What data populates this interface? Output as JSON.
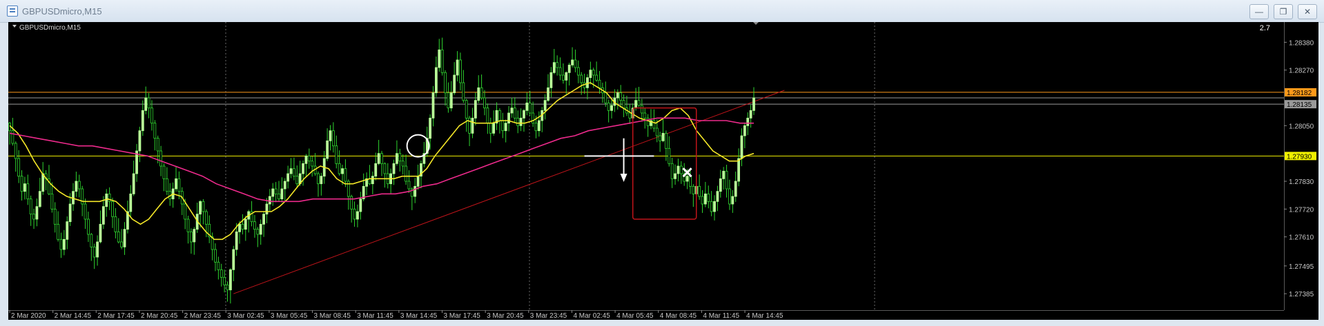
{
  "window": {
    "title": "GBPUSDmicro,M15",
    "minimize_icon": "minimize-icon",
    "restore_icon": "restore-icon",
    "close_icon": "close-icon",
    "minimize_glyph": "—",
    "restore_glyph": "❐",
    "close_glyph": "✕"
  },
  "chart_data": {
    "type": "candlestick",
    "symbol_label": "GBPUSDmicro,M15",
    "top_right_value": "2.7",
    "ylim": [
      1.2732,
      1.2846
    ],
    "y_ticks": [
      "1.28380",
      "1.28270",
      "1.28050",
      "1.27830",
      "1.27720",
      "1.27610",
      "1.27495",
      "1.27385"
    ],
    "x_ticks": [
      "2 Mar 2020",
      "2 Mar 14:45",
      "2 Mar 17:45",
      "2 Mar 20:45",
      "2 Mar 23:45",
      "3 Mar 02:45",
      "3 Mar 05:45",
      "3 Mar 08:45",
      "3 Mar 11:45",
      "3 Mar 14:45",
      "3 Mar 17:45",
      "3 Mar 20:45",
      "3 Mar 23:45",
      "4 Mar 02:45",
      "4 Mar 05:45",
      "4 Mar 08:45",
      "4 Mar 11:45",
      "4 Mar 14:45"
    ],
    "price_labels": [
      {
        "text": "1.28182",
        "value": 1.28182,
        "color": "#ff9a1a",
        "text_color": "#000000"
      },
      {
        "text": "1.28135",
        "value": 1.28135,
        "color": "#9a9a9a",
        "text_color": "#000000"
      },
      {
        "text": "1.27930",
        "value": 1.2793,
        "color": "#f0f000",
        "text_color": "#000000"
      }
    ],
    "horizontal_lines": [
      {
        "value": 1.28182,
        "color": "#ff9a1a"
      },
      {
        "value": 1.2816,
        "color": "#9a9a9a"
      },
      {
        "value": 1.28135,
        "color": "#9a9a9a"
      },
      {
        "value": 1.2793,
        "color": "#f0f000"
      }
    ],
    "closes": [
      1.2803,
      1.2798,
      1.2792,
      1.2785,
      1.2779,
      1.2782,
      1.2776,
      1.277,
      1.2768,
      1.2773,
      1.2779,
      1.2786,
      1.2784,
      1.2778,
      1.2772,
      1.2766,
      1.276,
      1.2756,
      1.276,
      1.2767,
      1.2774,
      1.2779,
      1.2783,
      1.278,
      1.2774,
      1.2768,
      1.2762,
      1.2757,
      1.2753,
      1.2759,
      1.2766,
      1.2773,
      1.2778,
      1.2775,
      1.2769,
      1.2763,
      1.2759,
      1.2757,
      1.2764,
      1.2771,
      1.2778,
      1.2786,
      1.2795,
      1.2803,
      1.2811,
      1.2816,
      1.2812,
      1.2806,
      1.28,
      1.2795,
      1.2789,
      1.2784,
      1.2779,
      1.2776,
      1.278,
      1.2784,
      1.2779,
      1.2774,
      1.2768,
      1.2763,
      1.2759,
      1.2764,
      1.277,
      1.2775,
      1.2771,
      1.2766,
      1.2761,
      1.2756,
      1.2751,
      1.2748,
      1.2745,
      1.2742,
      1.274,
      1.2748,
      1.2756,
      1.2763,
      1.2766,
      1.2764,
      1.2768,
      1.2771,
      1.2767,
      1.2764,
      1.2762,
      1.2766,
      1.277,
      1.2774,
      1.2777,
      1.278,
      1.2778,
      1.2776,
      1.278,
      1.2783,
      1.2786,
      1.2788,
      1.2785,
      1.2782,
      1.2786,
      1.279,
      1.2793,
      1.2791,
      1.2789,
      1.2786,
      1.2782,
      1.2785,
      1.2792,
      1.2799,
      1.2803,
      1.2797,
      1.279,
      1.2786,
      1.2788,
      1.2783,
      1.2777,
      1.2772,
      1.2768,
      1.2771,
      1.2776,
      1.2781,
      1.2784,
      1.2782,
      1.2785,
      1.279,
      1.2794,
      1.279,
      1.2786,
      1.2782,
      1.2786,
      1.279,
      1.2794,
      1.2791,
      1.2789,
      1.2783,
      1.278,
      1.2777,
      1.2781,
      1.2785,
      1.279,
      1.2794,
      1.28,
      1.2808,
      1.2818,
      1.2828,
      1.2835,
      1.2826,
      1.2818,
      1.2812,
      1.2818,
      1.2825,
      1.2831,
      1.2822,
      1.2815,
      1.2808,
      1.2802,
      1.2808,
      1.2815,
      1.282,
      1.2816,
      1.2812,
      1.2806,
      1.2802,
      1.2806,
      1.2811,
      1.2807,
      1.2803,
      1.2806,
      1.281,
      1.2812,
      1.2808,
      1.2805,
      1.2808,
      1.2811,
      1.2814,
      1.281,
      1.2806,
      1.2803,
      1.2807,
      1.2811,
      1.2815,
      1.282,
      1.2826,
      1.283,
      1.2828,
      1.2825,
      1.2823,
      1.2826,
      1.2829,
      1.2831,
      1.2828,
      1.2825,
      1.2822,
      1.282,
      1.2824,
      1.2827,
      1.2825,
      1.2823,
      1.282,
      1.2818,
      1.2814,
      1.2811,
      1.2813,
      1.2816,
      1.2818,
      1.2815,
      1.2812,
      1.281,
      1.2808,
      1.2812,
      1.2815,
      1.2813,
      1.281,
      1.2808,
      1.2805,
      1.2807,
      1.2804,
      1.2801,
      1.2799,
      1.2802,
      1.2796,
      1.279,
      1.2784,
      1.2786,
      1.2789,
      1.2786,
      1.2783,
      1.2785,
      1.2781,
      1.2778,
      1.2781,
      1.2777,
      1.2774,
      1.2778,
      1.2775,
      1.2771,
      1.2775,
      1.2779,
      1.2784,
      1.2787,
      1.278,
      1.2774,
      1.2777,
      1.2783,
      1.2792,
      1.2801,
      1.2805,
      1.2808,
      1.2811,
      1.2816
    ],
    "candle_count": 247,
    "series": [
      {
        "name": "",
        "color": "#f5e828",
        "values": [
          1.2805,
          1.2802,
          1.2797,
          1.2791,
          1.2786,
          1.2782,
          1.2779,
          1.2777,
          1.2776,
          1.2775,
          1.2775,
          1.2775,
          1.2776,
          1.2775,
          1.2772,
          1.2768,
          1.2766,
          1.2768,
          1.2772,
          1.2776,
          1.2778,
          1.2777,
          1.2772,
          1.2767,
          1.2763,
          1.276,
          1.276,
          1.2762,
          1.2766,
          1.2769,
          1.2771,
          1.2771,
          1.2771,
          1.2773,
          1.2776,
          1.278,
          1.2784,
          1.2787,
          1.2789,
          1.2788,
          1.2784,
          1.2782,
          1.2782,
          1.2783,
          1.2784,
          1.2784,
          1.2784,
          1.2784,
          1.2785,
          1.2785,
          1.2785,
          1.2788,
          1.2793,
          1.2797,
          1.2801,
          1.2805,
          1.2807,
          1.2806,
          1.2806,
          1.2806,
          1.2807,
          1.2807,
          1.2806,
          1.2806,
          1.2807,
          1.2809,
          1.2812,
          1.2815,
          1.2817,
          1.2819,
          1.2821,
          1.2822,
          1.282,
          1.2818,
          1.2814,
          1.2812,
          1.281,
          1.2808,
          1.2807,
          1.2806,
          1.2808,
          1.2811,
          1.2812,
          1.2809,
          1.2803,
          1.2799,
          1.2795,
          1.2793,
          1.2791,
          1.2791,
          1.2793,
          1.2794
        ]
      },
      {
        "name": "",
        "color": "#ee2a8c",
        "values": [
          1.2802,
          1.2801,
          1.28,
          1.2799,
          1.2798,
          1.2797,
          1.2797,
          1.2796,
          1.2795,
          1.2794,
          1.2793,
          1.2791,
          1.2789,
          1.2787,
          1.2785,
          1.2782,
          1.278,
          1.2778,
          1.2776,
          1.2775,
          1.2775,
          1.2775,
          1.2776,
          1.2776,
          1.2776,
          1.2776,
          1.2777,
          1.2778,
          1.2778,
          1.2779,
          1.2781,
          1.2782,
          1.2784,
          1.2786,
          1.2788,
          1.279,
          1.2792,
          1.2794,
          1.2796,
          1.2798,
          1.28,
          1.2801,
          1.2803,
          1.2804,
          1.2805,
          1.2806,
          1.2807,
          1.2808,
          1.2808,
          1.2808,
          1.2807,
          1.2807,
          1.2807,
          1.2806,
          1.2806
        ]
      }
    ],
    "annotations": {
      "trendline_color": "#c0141a",
      "rectangle_color": "#c0141a",
      "circle_color": "#ffffff",
      "arrow_color": "#ffffff",
      "cross_color": "#ffffff"
    },
    "colors": {
      "background": "#000000",
      "candle": "#ffffff",
      "bull_candle": "#b9ff98",
      "wick": "#2fd62f",
      "grid": "#6a6a6a",
      "axis_text": "#c8c8c8"
    },
    "grid": "vertical-dotted",
    "legend": "none"
  }
}
